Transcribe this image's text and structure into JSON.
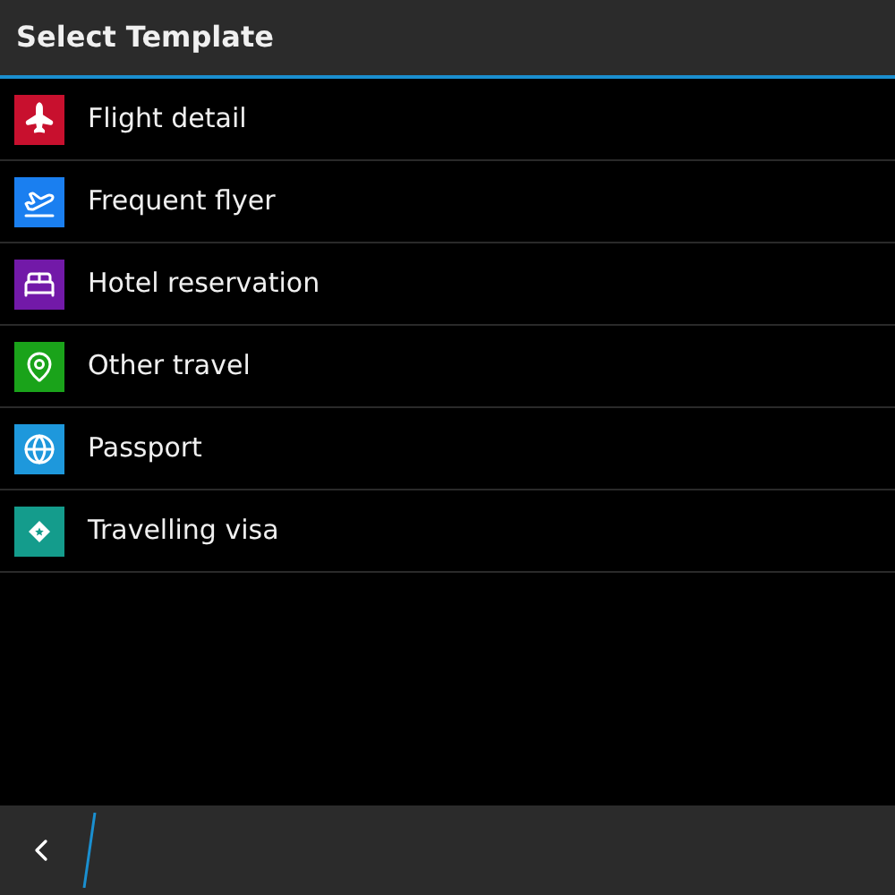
{
  "title": "Select Template",
  "items": [
    {
      "label": "Flight detail",
      "kind": "flight",
      "color": "#c8102e"
    },
    {
      "label": "Frequent flyer",
      "kind": "flyer",
      "color": "#1a7ff0"
    },
    {
      "label": "Hotel reservation",
      "kind": "hotel",
      "color": "#7219a8"
    },
    {
      "label": "Other travel",
      "kind": "pin",
      "color": "#1aa31a"
    },
    {
      "label": "Passport",
      "kind": "globe",
      "color": "#1e98dc"
    },
    {
      "label": "Travelling visa",
      "kind": "visa",
      "color": "#149c8c"
    }
  ]
}
